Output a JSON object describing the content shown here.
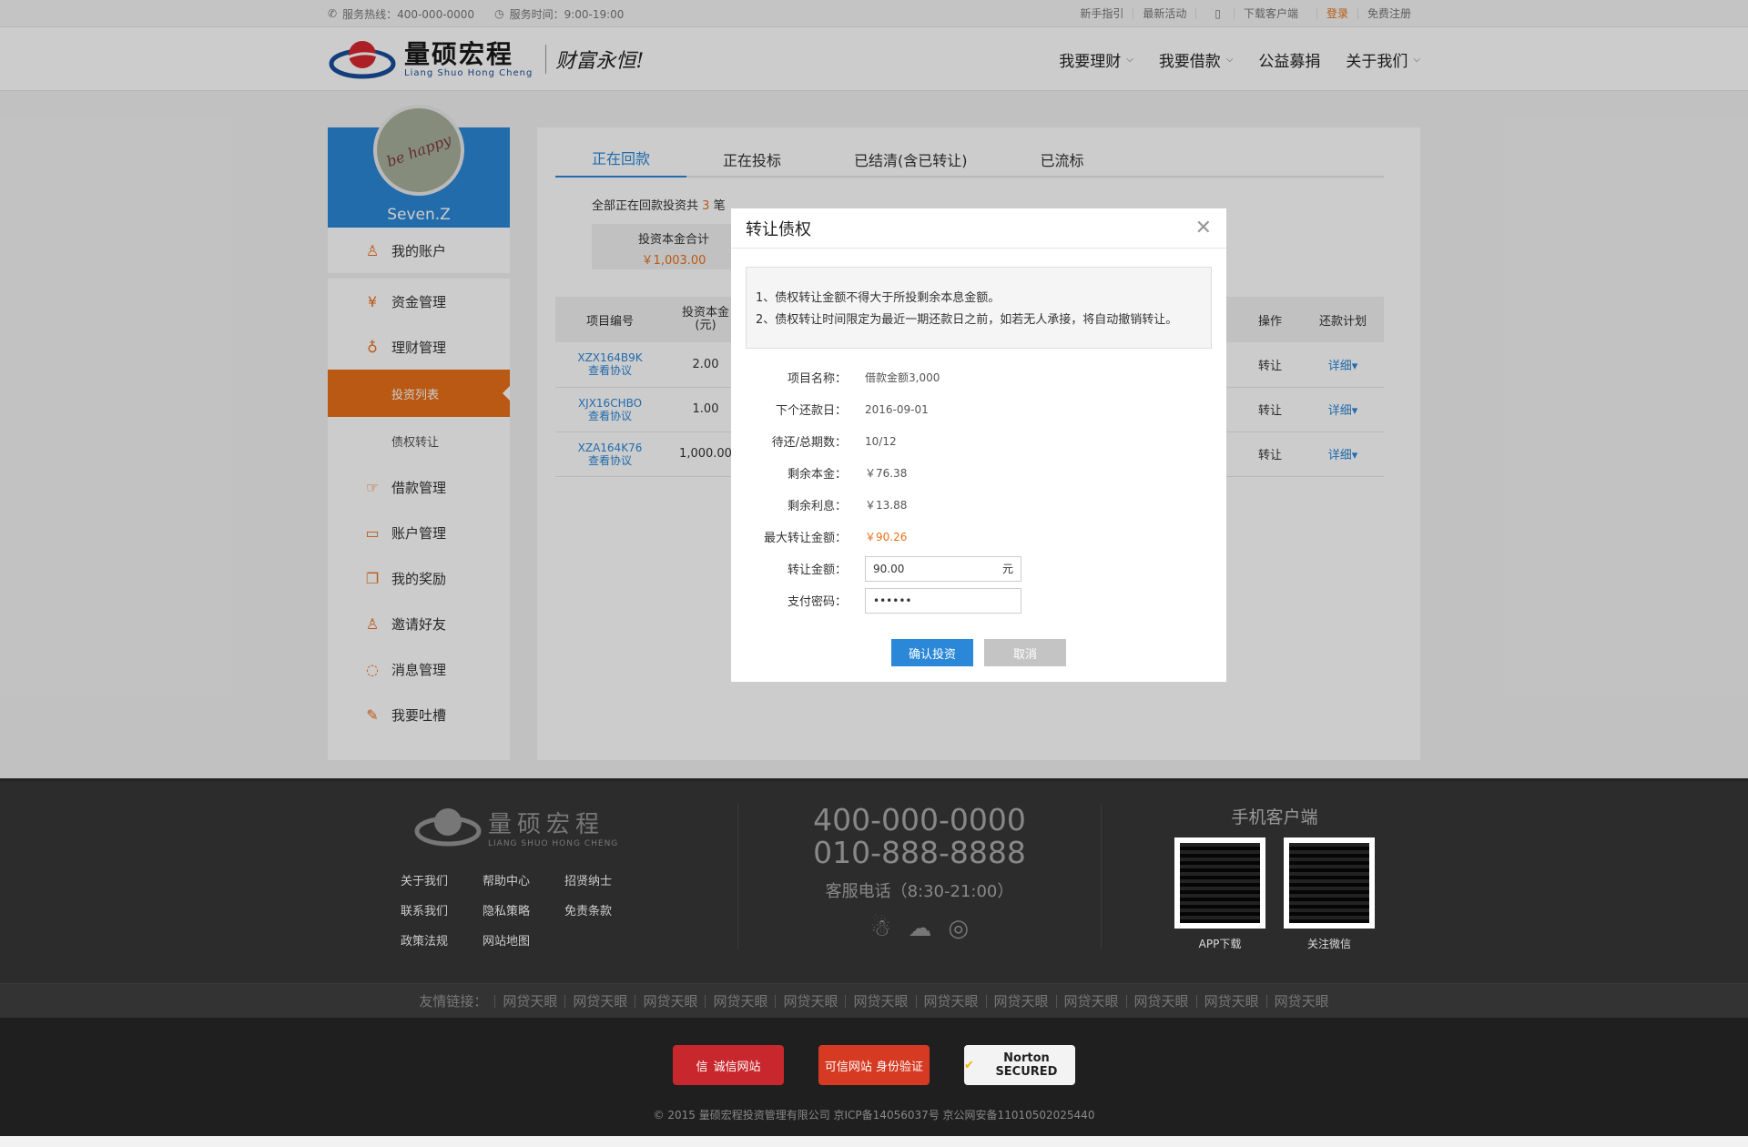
{
  "topbar": {
    "hotline": "服务热线：400-000-0000",
    "service_time": "服务时间：9:00-19:00",
    "links": [
      "新手指引",
      "最新活动",
      "下载客户端"
    ],
    "login": "登录",
    "register": "免费注册"
  },
  "header": {
    "logo_cn": "量硕宏程",
    "logo_en": "Liang Shuo Hong Cheng",
    "slogan": "财富永恒!",
    "nav": [
      "我要理财",
      "我要借款",
      "公益募捐",
      "关于我们"
    ]
  },
  "sidebar": {
    "username": "Seven.Z",
    "avatar_text": "be happy",
    "items": [
      {
        "label": "我的账户",
        "icon": "user-icon"
      },
      {
        "label": "资金管理",
        "icon": "yen-icon"
      },
      {
        "label": "理财管理",
        "icon": "money-bag-icon"
      },
      {
        "label": "借款管理",
        "icon": "hand-money-icon"
      },
      {
        "label": "账户管理",
        "icon": "card-icon"
      },
      {
        "label": "我的奖励",
        "icon": "gift-icon"
      },
      {
        "label": "邀请好友",
        "icon": "add-user-icon"
      },
      {
        "label": "消息管理",
        "icon": "message-icon"
      },
      {
        "label": "我要吐槽",
        "icon": "edit-icon"
      }
    ],
    "subitems": [
      "投资列表",
      "债权转让"
    ]
  },
  "content": {
    "tabs": [
      "正在回款",
      "正在投标",
      "已结清(含已转让)",
      "已流标"
    ],
    "summary_prefix": "全部正在回款投资共",
    "summary_count": "3",
    "summary_suffix": "笔",
    "total_label": "投资本金合计",
    "total_value": "￥1,003.00",
    "table_headers": [
      "项目编号",
      "投资本金\n(元)",
      "操作",
      "还款计划"
    ],
    "rows": [
      {
        "id": "XZX164B9K",
        "agreement": "查看协议",
        "amount": "2.00",
        "action": "转让",
        "plan": "详细"
      },
      {
        "id": "XJX16CHBO",
        "agreement": "查看协议",
        "amount": "1.00",
        "action": "转让",
        "plan": "详细"
      },
      {
        "id": "XZA164K76",
        "agreement": "查看协议",
        "amount": "1,000.00",
        "action": "转让",
        "plan": "详细"
      }
    ]
  },
  "modal": {
    "title": "转让债权",
    "notice_1": "1、债权转让金额不得大于所投剩余本息金额。",
    "notice_2": "2、债权转让时间限定为最近一期还款日之前，如若无人承接，将自动撤销转让。",
    "fields": [
      {
        "label": "项目名称：",
        "value": "借款金额3,000"
      },
      {
        "label": "下个还款日：",
        "value": "2016-09-01"
      },
      {
        "label": "待还/总期数：",
        "value": "10/12"
      },
      {
        "label": "剩余本金：",
        "value": "￥76.38"
      },
      {
        "label": "剩余利息：",
        "value": "￥13.88"
      },
      {
        "label": "最大转让金额：",
        "value": "￥90.26"
      }
    ],
    "amount_label": "转让金额：",
    "amount_value": "90.00",
    "amount_unit": "元",
    "password_label": "支付密码：",
    "password_value": "••••••",
    "confirm": "确认投资",
    "cancel": "取消"
  },
  "footer": {
    "logo_cn": "量硕宏程",
    "logo_en": "LIANG SHUO HONG CHENG",
    "links": [
      "关于我们",
      "帮助中心",
      "招贤纳士",
      "联系我们",
      "隐私策略",
      "免责条款",
      "政策法规",
      "网站地图"
    ],
    "phone1": "400-000-0000",
    "phone2": "010-888-8888",
    "hours": "客服电话（8:30-21:00）",
    "app_title": "手机客户端",
    "qr1": "APP下载",
    "qr2": "关注微信",
    "friend_label": "友情链接：",
    "friend_links": [
      "网贷天眼",
      "网贷天眼",
      "网贷天眼",
      "网贷天眼",
      "网贷天眼",
      "网贷天眼",
      "网贷天眼",
      "网贷天眼",
      "网贷天眼",
      "网贷天眼",
      "网贷天眼",
      "网贷天眼"
    ],
    "badges": [
      "诚信网站",
      "可信网站 身份验证",
      "Norton SECURED"
    ],
    "copyright": "© 2015 量硕宏程投资管理有限公司 京ICP备14056037号 京公网安备11010502025440"
  }
}
